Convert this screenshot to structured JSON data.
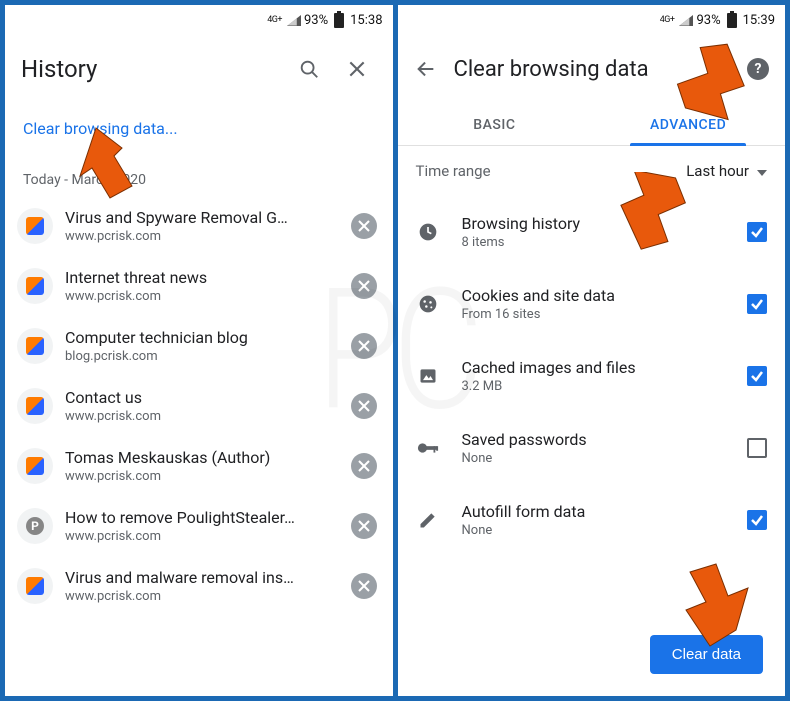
{
  "statusbar": {
    "network": "4G+",
    "battery_pct": "93%",
    "time_left": "15:38",
    "time_right": "15:39"
  },
  "left": {
    "title": "History",
    "clear_link": "Clear browsing data...",
    "date_header": "Today - March 2020",
    "items": [
      {
        "title": "Virus and Spyware Removal G…",
        "url": "www.pcrisk.com",
        "icon": "pcrisk"
      },
      {
        "title": "Internet threat news",
        "url": "www.pcrisk.com",
        "icon": "pcrisk"
      },
      {
        "title": "Computer technician blog",
        "url": "blog.pcrisk.com",
        "icon": "pcrisk"
      },
      {
        "title": "Contact us",
        "url": "www.pcrisk.com",
        "icon": "pcrisk"
      },
      {
        "title": "Tomas Meskauskas (Author)",
        "url": "www.pcrisk.com",
        "icon": "pcrisk"
      },
      {
        "title": "How to remove PoulightStealer…",
        "url": "www.pcrisk.com",
        "icon": "p"
      },
      {
        "title": "Virus and malware removal ins…",
        "url": "www.pcrisk.com",
        "icon": "pcrisk"
      }
    ]
  },
  "right": {
    "title": "Clear browsing data",
    "tabs": {
      "basic": "BASIC",
      "advanced": "ADVANCED"
    },
    "timerange_label": "Time range",
    "timerange_value": "Last hour",
    "items": [
      {
        "icon": "clock",
        "title": "Browsing history",
        "sub": "8 items",
        "checked": true
      },
      {
        "icon": "cookie",
        "title": "Cookies and site data",
        "sub": "From 16 sites",
        "checked": true
      },
      {
        "icon": "image",
        "title": "Cached images and files",
        "sub": "3.2 MB",
        "checked": true
      },
      {
        "icon": "key",
        "title": "Saved passwords",
        "sub": "None",
        "checked": false
      },
      {
        "icon": "pencil",
        "title": "Autofill form data",
        "sub": "None",
        "checked": true
      }
    ],
    "button": "Clear data"
  },
  "icons": {
    "search": "search-icon",
    "close": "close-icon",
    "back": "back-icon",
    "help": "help-icon",
    "delete": "delete-icon",
    "dropdown": "chevron-down-icon"
  },
  "colors": {
    "accent": "#1a73e8",
    "arrow": "#e8590c"
  }
}
